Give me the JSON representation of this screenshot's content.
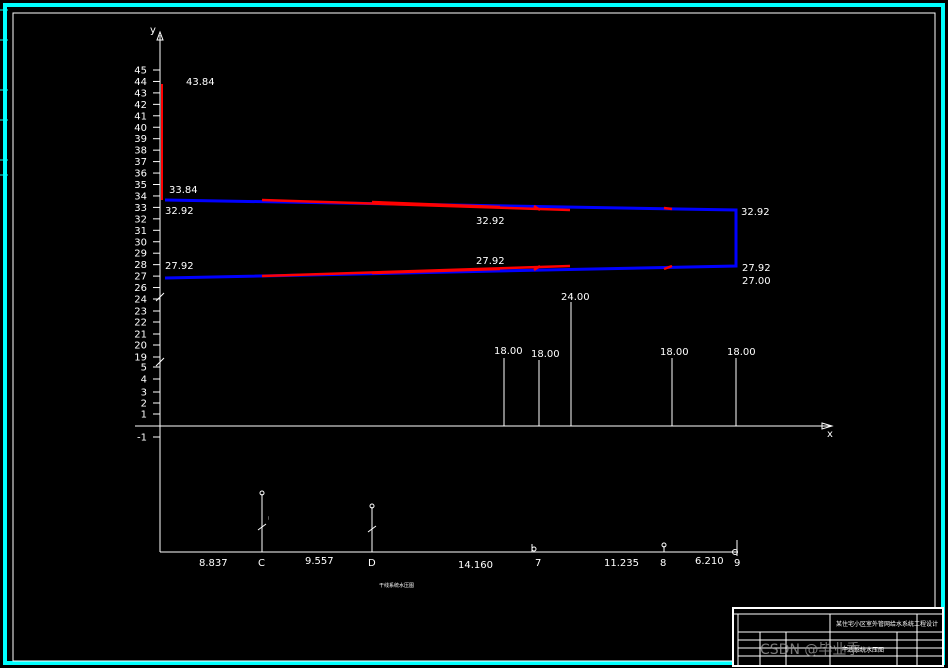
{
  "drawing": {
    "axis_y_label": "y",
    "axis_x_label": "x",
    "y_ticks_upper": [
      "45",
      "44",
      "43",
      "42",
      "41",
      "40",
      "39",
      "38",
      "37",
      "36",
      "35",
      "34",
      "33",
      "32",
      "31",
      "30",
      "29",
      "28",
      "27",
      "26"
    ],
    "y_ticks_lower": [
      "24",
      "23",
      "22",
      "21",
      "20",
      "19",
      "5",
      "4",
      "3",
      "2",
      "1",
      "-1"
    ],
    "left_labels": {
      "top": "43.84",
      "mid_high": "33.84",
      "mid": "32.92",
      "low": "27.92"
    },
    "inner_labels": {
      "upper_line": "32.92",
      "lower_line": "27.92"
    },
    "right_labels": {
      "upper": "32.92",
      "lower": "27.92",
      "base": "27.00"
    },
    "bar_labels": [
      {
        "label": "18.00",
        "x_pos": "504"
      },
      {
        "label": "18.00",
        "x_pos": "539"
      },
      {
        "label": "24.00",
        "x_pos": "571"
      },
      {
        "label": "18.00",
        "x_pos": "672"
      },
      {
        "label": "18.00",
        "x_pos": "736"
      }
    ],
    "bottom_segments": [
      "8.837",
      "9.557",
      "14.160",
      "11.235",
      "6.210"
    ],
    "bottom_nodes": [
      "C",
      "D",
      "7",
      "8",
      "9"
    ],
    "bottom_caption": "干线系统水压图",
    "title_block": {
      "title": "某住宅小区室外管网给水系统工程设计",
      "subtitle": "干线系统水压图",
      "watermark": "CSDN @毕业季"
    }
  }
}
